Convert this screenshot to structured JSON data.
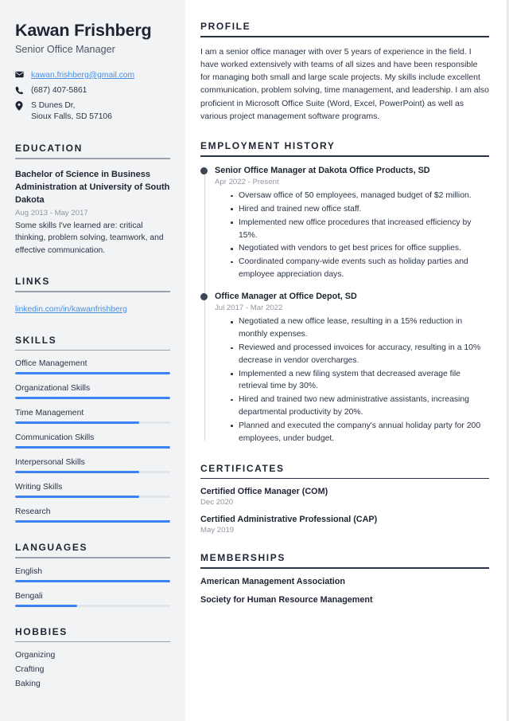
{
  "sidebar": {
    "name": "Kawan Frishberg",
    "job_title": "Senior Office Manager",
    "contact": {
      "email": "kawan.frishberg@gmail.com",
      "phone": "(687) 407-5861",
      "address_line1": "S Dunes Dr,",
      "address_line2": "Sioux Falls, SD 57106"
    },
    "education": {
      "heading": "EDUCATION",
      "degree": "Bachelor of Science in Business Administration at University of South Dakota",
      "date": "Aug 2013 - May 2017",
      "description": "Some skills I've learned are: critical thinking, problem solving, teamwork, and effective communication."
    },
    "links": {
      "heading": "LINKS",
      "items": [
        {
          "label": "linkedin.com/in/kawanfrishberg"
        }
      ]
    },
    "skills": {
      "heading": "SKILLS",
      "items": [
        {
          "label": "Office Management",
          "level": 100
        },
        {
          "label": "Organizational Skills",
          "level": 100
        },
        {
          "label": "Time Management",
          "level": 80
        },
        {
          "label": "Communication Skills",
          "level": 100
        },
        {
          "label": "Interpersonal Skills",
          "level": 80
        },
        {
          "label": "Writing Skills",
          "level": 80
        },
        {
          "label": "Research",
          "level": 100
        }
      ]
    },
    "languages": {
      "heading": "LANGUAGES",
      "items": [
        {
          "label": "English",
          "level": 100
        },
        {
          "label": "Bengali",
          "level": 40
        }
      ]
    },
    "hobbies": {
      "heading": "HOBBIES",
      "items": [
        {
          "label": "Organizing"
        },
        {
          "label": "Crafting"
        },
        {
          "label": "Baking"
        }
      ]
    }
  },
  "main": {
    "profile": {
      "heading": "PROFILE",
      "text": "I am a senior office manager with over 5 years of experience in the field. I have worked extensively with teams of all sizes and have been responsible for managing both small and large scale projects. My skills include excellent communication, problem solving, time management, and leadership. I am also proficient in Microsoft Office Suite (Word, Excel, PowerPoint) as well as various project management software programs."
    },
    "employment": {
      "heading": "EMPLOYMENT HISTORY",
      "jobs": [
        {
          "title": "Senior Office Manager at Dakota Office Products, SD",
          "date": "Apr 2022 - Present",
          "bullets": [
            "Oversaw office of 50 employees, managed budget of $2 million.",
            "Hired and trained new office staff.",
            "Implemented new office procedures that increased efficiency by 15%.",
            "Negotiated with vendors to get best prices for office supplies.",
            "Coordinated company-wide events such as holiday parties and employee appreciation days."
          ]
        },
        {
          "title": "Office Manager at Office Depot, SD",
          "date": "Jul 2017 - Mar 2022",
          "bullets": [
            "Negotiated a new office lease, resulting in a 15% reduction in monthly expenses.",
            "Reviewed and processed invoices for accuracy, resulting in a 10% decrease in vendor overcharges.",
            "Implemented a new filing system that decreased average file retrieval time by 30%.",
            "Hired and trained two new administrative assistants, increasing departmental productivity by 20%.",
            "Planned and executed the company's annual holiday party for 200 employees, under budget."
          ]
        }
      ]
    },
    "certificates": {
      "heading": "CERTIFICATES",
      "items": [
        {
          "title": "Certified Office Manager (COM)",
          "date": "Dec 2020"
        },
        {
          "title": "Certified Administrative Professional (CAP)",
          "date": "May 2019"
        }
      ]
    },
    "memberships": {
      "heading": "MEMBERSHIPS",
      "items": [
        {
          "label": "American Management Association"
        },
        {
          "label": "Society for Human Resource Management"
        }
      ]
    }
  }
}
